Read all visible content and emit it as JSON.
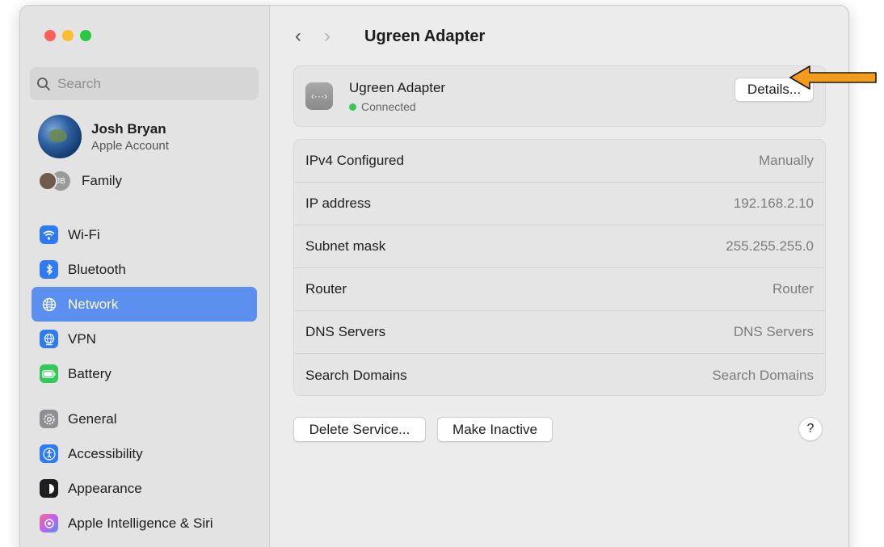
{
  "window": {
    "title": "Ugreen Adapter",
    "traffic_lights": [
      "close",
      "minimize",
      "zoom"
    ]
  },
  "sidebar": {
    "search_placeholder": "Search",
    "account": {
      "name": "Josh Bryan",
      "subtitle": "Apple Account"
    },
    "family": {
      "initials": "JB",
      "label": "Family"
    },
    "items": [
      {
        "label": "Wi-Fi",
        "icon": "wifi-icon"
      },
      {
        "label": "Bluetooth",
        "icon": "bluetooth-icon"
      },
      {
        "label": "Network",
        "icon": "network-globe-icon",
        "active": true
      },
      {
        "label": "VPN",
        "icon": "vpn-globe-icon"
      },
      {
        "label": "Battery",
        "icon": "battery-icon"
      },
      {
        "label": "General",
        "icon": "gear-icon"
      },
      {
        "label": "Accessibility",
        "icon": "accessibility-icon"
      },
      {
        "label": "Appearance",
        "icon": "appearance-icon"
      },
      {
        "label": "Apple Intelligence & Siri",
        "icon": "siri-icon"
      }
    ]
  },
  "main": {
    "adapter": {
      "name": "Ugreen Adapter",
      "status": "Connected",
      "icon_glyph": "‹···›"
    },
    "details_button": "Details...",
    "info_rows": [
      {
        "label": "IPv4 Configured",
        "value": "Manually"
      },
      {
        "label": "IP address",
        "value": "192.168.2.10"
      },
      {
        "label": "Subnet mask",
        "value": "255.255.255.0"
      },
      {
        "label": "Router",
        "value": "Router"
      },
      {
        "label": "DNS Servers",
        "value": "DNS Servers"
      },
      {
        "label": "Search Domains",
        "value": "Search Domains"
      }
    ],
    "delete_button": "Delete Service...",
    "inactive_button": "Make Inactive",
    "help_button": "?"
  },
  "colors": {
    "accent": "#5b8ff0",
    "status_green": "#34c759",
    "annotation_arrow": "#f39c1c"
  }
}
